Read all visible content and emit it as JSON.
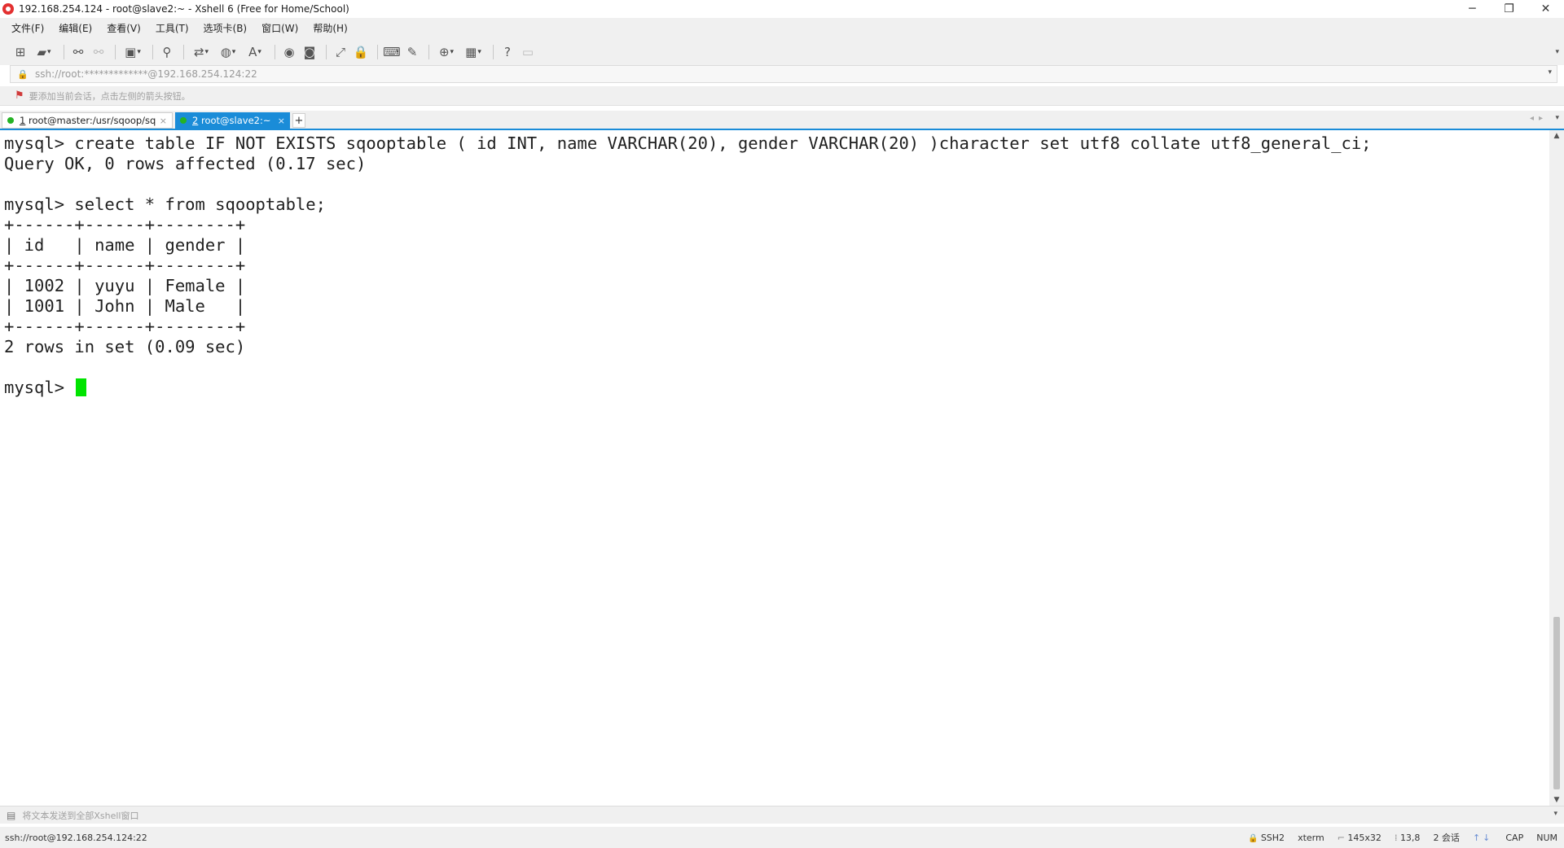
{
  "window": {
    "title": "192.168.254.124 - root@slave2:~ - Xshell 6 (Free for Home/School)",
    "minimize": "─",
    "restore": "❐",
    "close": "✕"
  },
  "menu": [
    "文件(F)",
    "编辑(E)",
    "查看(V)",
    "工具(T)",
    "选项卡(B)",
    "窗口(W)",
    "帮助(H)"
  ],
  "address": {
    "value": "ssh://root:*************@192.168.254.124:22"
  },
  "hint": {
    "text": "要添加当前会话，点击左侧的箭头按钮。"
  },
  "tabs": [
    {
      "num": "1",
      "label": " root@master:/usr/sqoop/sq...",
      "active": false
    },
    {
      "num": "2",
      "label": " root@slave2:~",
      "active": true
    }
  ],
  "terminal": {
    "lines": [
      "mysql> create table IF NOT EXISTS sqooptable ( id INT, name VARCHAR(20), gender VARCHAR(20) )character set utf8 collate utf8_general_ci;",
      "Query OK, 0 rows affected (0.17 sec)",
      "",
      "mysql> select * from sqooptable;",
      "+------+------+--------+",
      "| id   | name | gender |",
      "+------+------+--------+",
      "| 1002 | yuyu | Female |",
      "| 1001 | John | Male   |",
      "+------+------+--------+",
      "2 rows in set (0.09 sec)",
      ""
    ],
    "prompt": "mysql> "
  },
  "sendbar": {
    "text": "将文本发送到全部Xshell窗口"
  },
  "status": {
    "connection": "ssh://root@192.168.254.124:22",
    "protocol": "SSH2",
    "terminal_type": "xterm",
    "size": "145x32",
    "cursor": "13,8",
    "sessions": "2 会话",
    "caps": "CAP",
    "num": "NUM"
  }
}
